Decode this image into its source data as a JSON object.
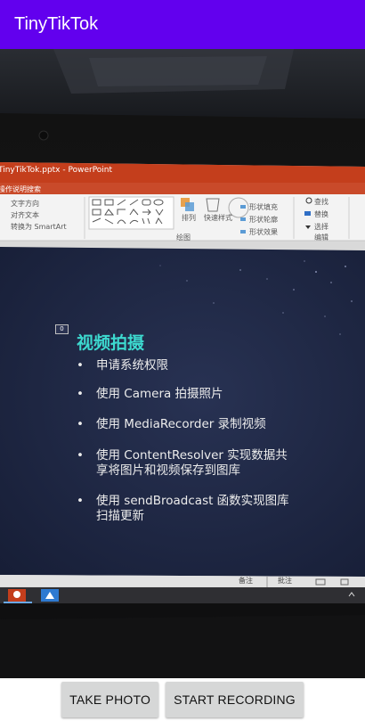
{
  "app": {
    "title": "TinyTikTok"
  },
  "photo": {
    "window_title": "TinyTikTok.pptx - PowerPoint",
    "ribbon": {
      "search_hint": "操作说明搜索",
      "text_direction": "文字方向",
      "align_text": "对齐文本",
      "convert_smartart": "转换为 SmartArt",
      "arrange": "排列",
      "quick_styles": "快速样式",
      "shape_fill": "形状填充",
      "shape_outline": "形状轮廓",
      "shape_effects": "形状效果",
      "find": "查找",
      "replace": "替换",
      "select": "选择",
      "group_drawing": "绘图",
      "group_editing": "编辑"
    },
    "slide": {
      "number": "0",
      "title": "视频拍摄",
      "bullets": [
        "申请系统权限",
        "使用 Camera 拍摄照片",
        "使用 MediaRecorder 录制视频",
        "使用 ContentResolver 实现数据共",
        "享将图片和视频保存到图库",
        "使用 sendBroadcast 函数实现图库",
        "扫描更新"
      ]
    },
    "status_bar": {
      "notes": "备注",
      "comments": "批注"
    }
  },
  "actions": {
    "take_photo": "TAKE PHOTO",
    "start_recording": "START RECORDING"
  },
  "colors": {
    "app_bar": "#6200ee",
    "ppt_orange": "#c43e1c",
    "slide_title": "#3dd9cf",
    "slide_background": "#1c2440",
    "button": "#d6d7d7"
  }
}
